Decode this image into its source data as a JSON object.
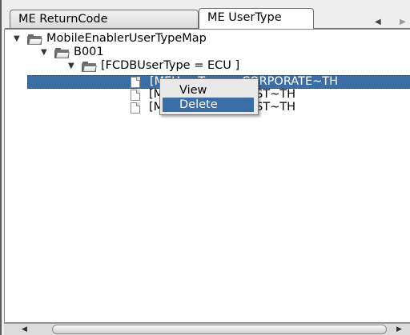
{
  "tabs": [
    {
      "label": "ME ReturnCode",
      "selected": false
    },
    {
      "label": "ME UserType",
      "selected": true
    }
  ],
  "tree": {
    "root": "MobileEnablerUserTypeMap",
    "child": "B001",
    "folder": "[FCDBUserType = ECU ]",
    "leaves": [
      "[MEUserType = CORPORATE~TH",
      "[MEUserType = TEST~TH",
      "[MEUserType = TEST~TH"
    ]
  },
  "context_menu": {
    "items": [
      "View",
      "Delete"
    ],
    "highlighted": "Delete"
  },
  "icons": {
    "expand": "triangle-down",
    "nav_left": "triangle-left",
    "nav_right": "triangle-right"
  },
  "colors": {
    "selection": "#3b6ea5",
    "background": "#ffffff",
    "panel": "#eeeeee"
  }
}
